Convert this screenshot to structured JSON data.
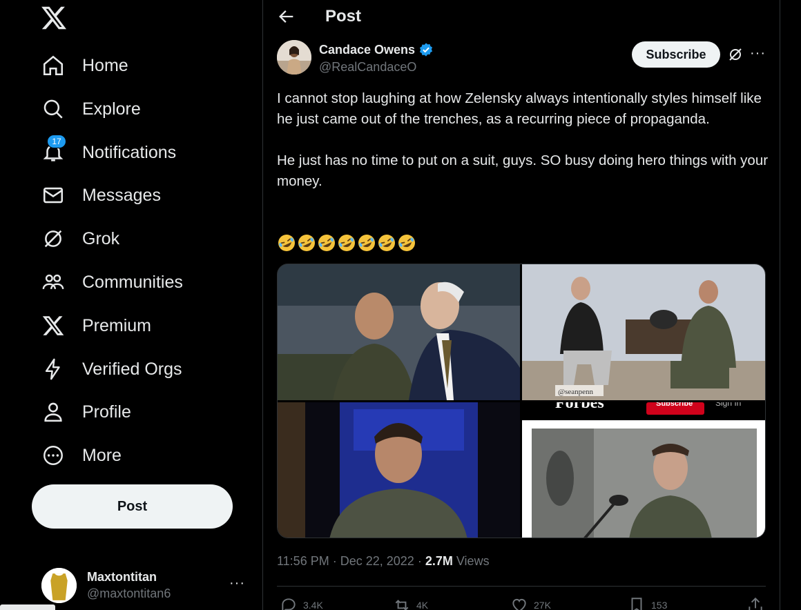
{
  "sidebar": {
    "logo_icon": "x-logo",
    "items": [
      {
        "label": "Home",
        "icon": "home-icon"
      },
      {
        "label": "Explore",
        "icon": "search-icon"
      },
      {
        "label": "Notifications",
        "icon": "bell-icon",
        "badge": "17"
      },
      {
        "label": "Messages",
        "icon": "envelope-icon"
      },
      {
        "label": "Grok",
        "icon": "grok-icon"
      },
      {
        "label": "Communities",
        "icon": "communities-icon"
      },
      {
        "label": "Premium",
        "icon": "x-premium-icon"
      },
      {
        "label": "Verified Orgs",
        "icon": "lightning-icon"
      },
      {
        "label": "Profile",
        "icon": "person-icon"
      },
      {
        "label": "More",
        "icon": "more-circle-icon"
      }
    ],
    "post_button": "Post",
    "account": {
      "name": "Maxtontitan",
      "handle": "@maxtontitan6",
      "more": "···"
    }
  },
  "header": {
    "title": "Post"
  },
  "tweet": {
    "author_name": "Candace Owens",
    "author_handle": "@RealCandaceO",
    "subscribe_label": "Subscribe",
    "more": "···",
    "text": "I cannot stop laughing at how Zelensky always intentionally styles himself like he just came out of the trenches, as a recurring piece of propaganda.\n\nHe just has no time to put on a suit, guys. SO busy doing hero things with your money.",
    "emoji_count": 7,
    "media_overlay_text": {
      "watermark": "@seanpenn",
      "masthead": "Forbes",
      "subscribe": "Subscribe",
      "sign_in": "Sign In"
    },
    "time": "11:56 PM",
    "date": "Dec 22, 2022",
    "views_count": "2.7M",
    "views_label": "Views",
    "actions": {
      "replies": "3.4K",
      "reposts": "4K",
      "likes": "27K",
      "bookmarks": "153"
    }
  },
  "colors": {
    "background": "#000000",
    "accent": "#1d9bf0",
    "text": "#e7e9ea",
    "muted": "#71767b",
    "border": "#2f3336"
  }
}
